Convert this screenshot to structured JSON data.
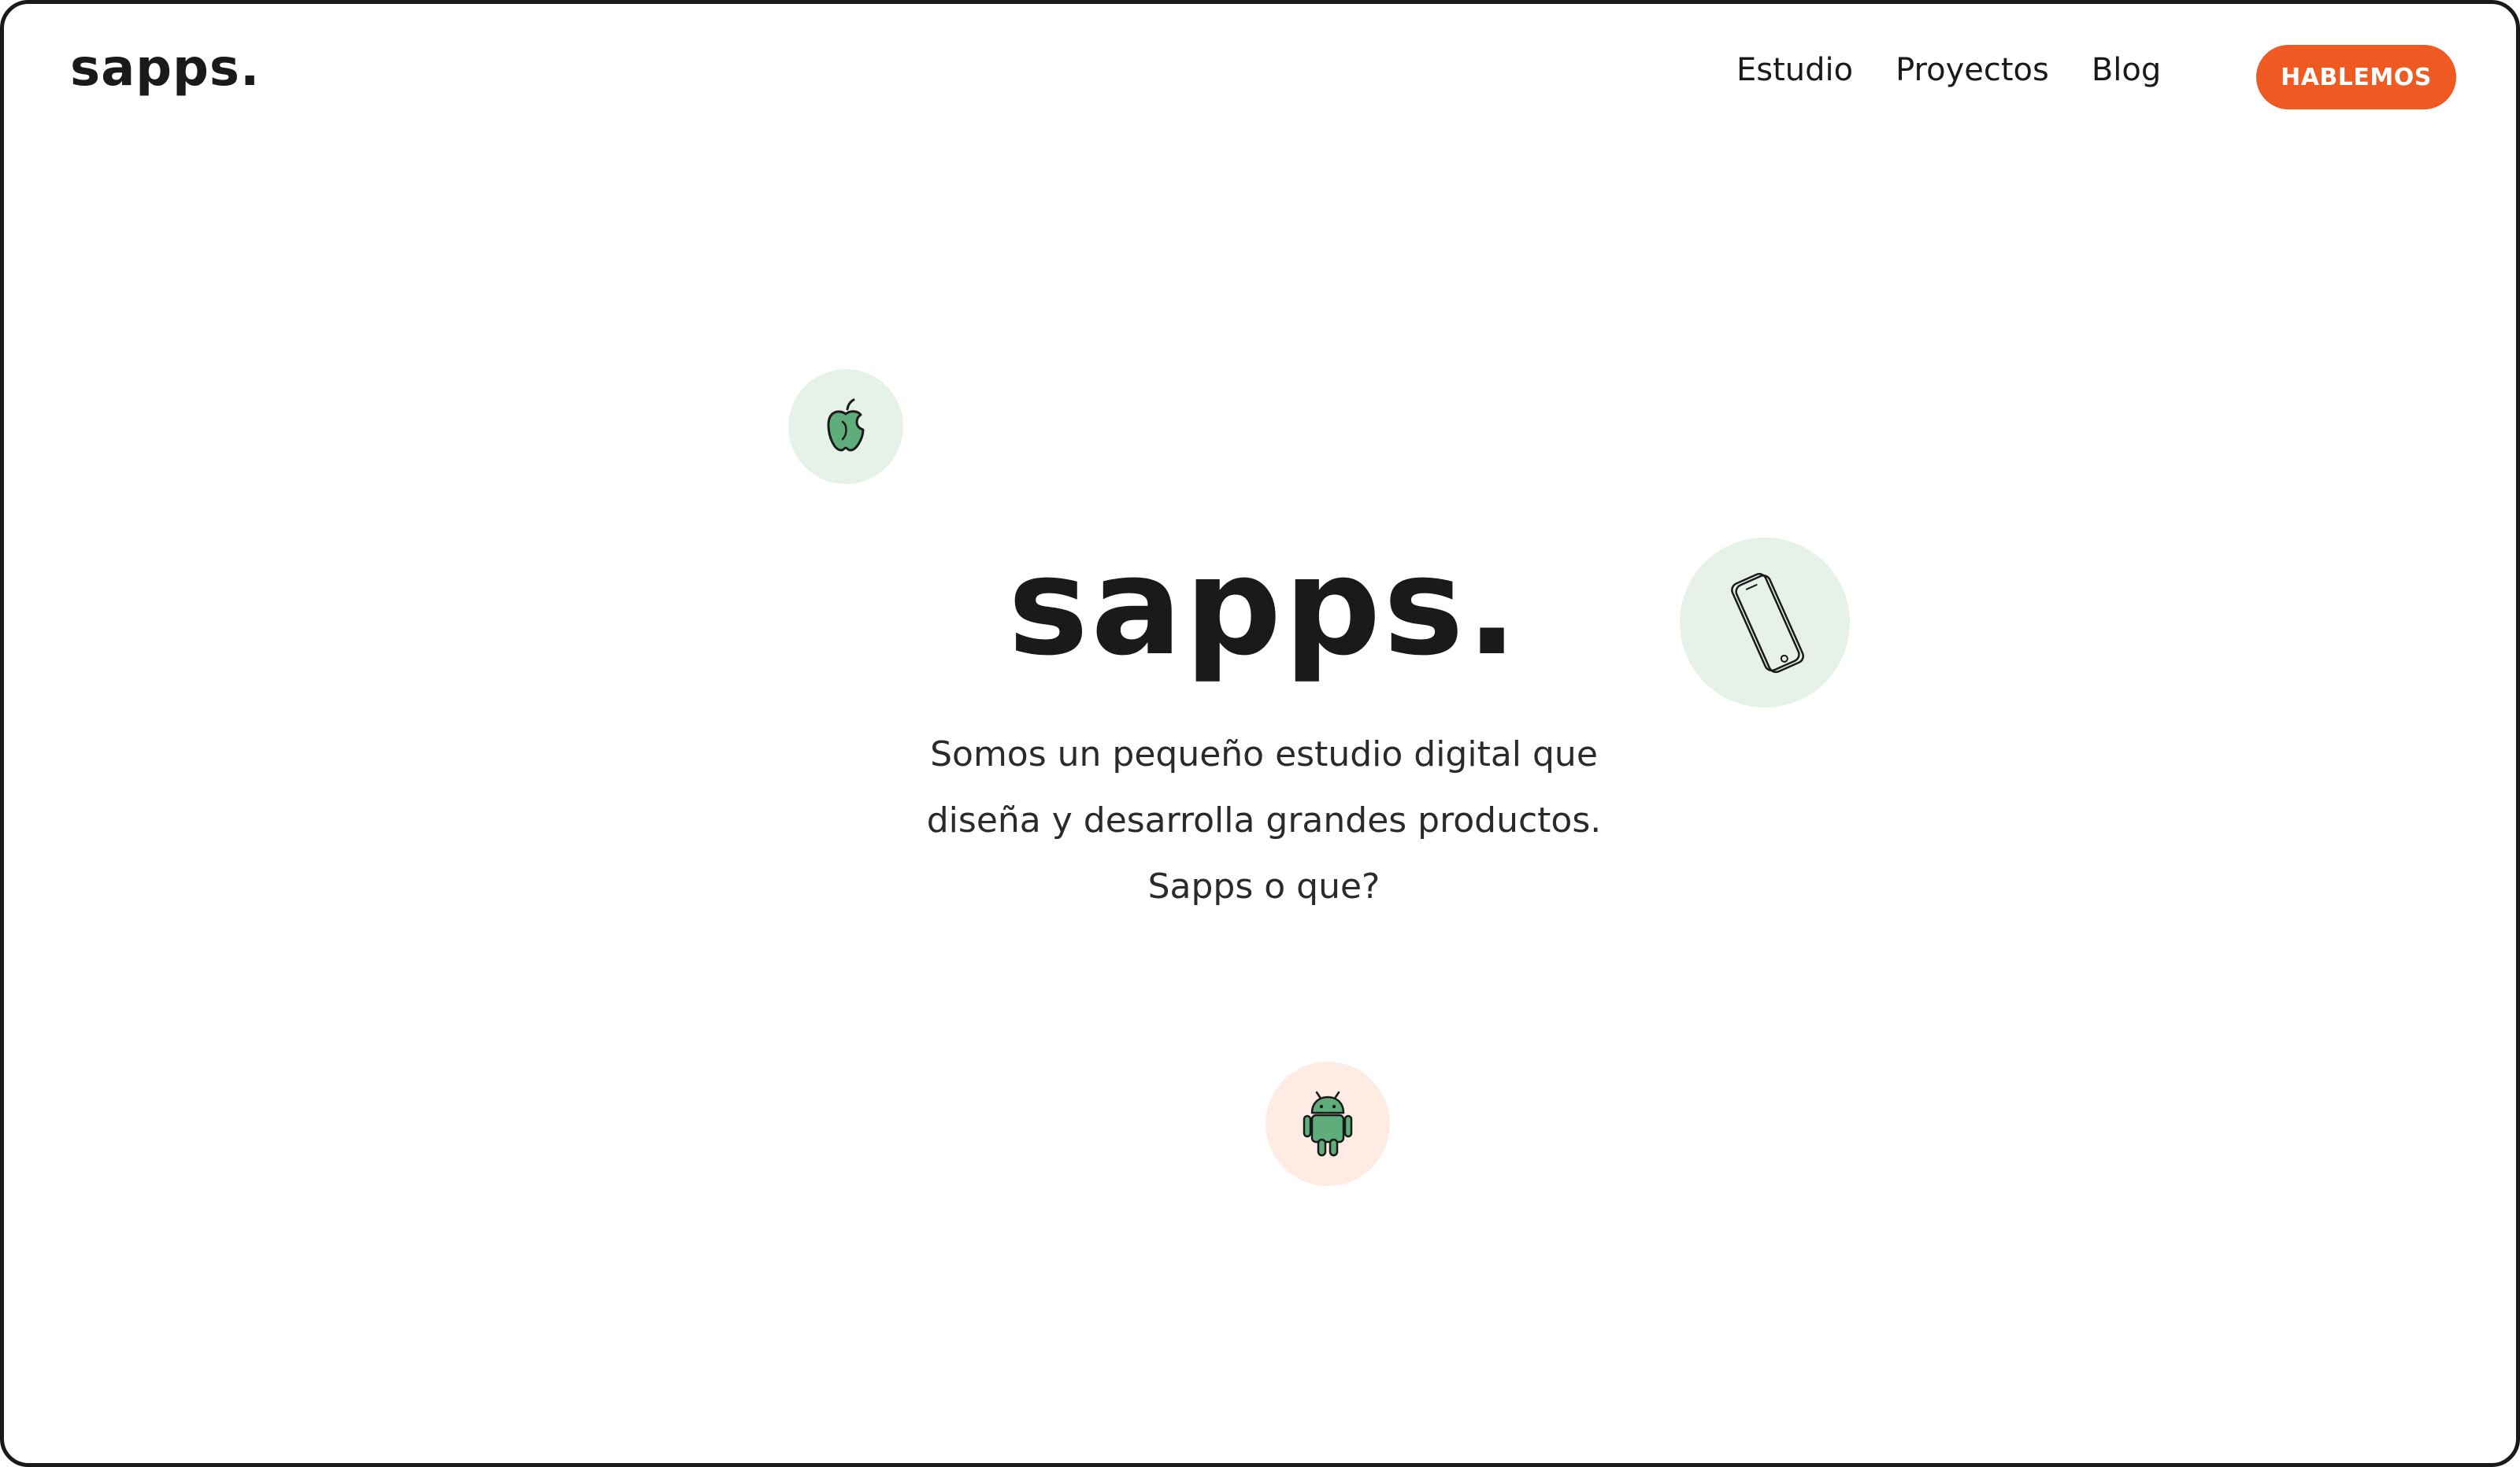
{
  "header": {
    "logo": "sapps.",
    "nav": [
      {
        "label": "Estudio"
      },
      {
        "label": "Proyectos"
      },
      {
        "label": "Blog"
      }
    ],
    "cta_label": "HABLEMOS"
  },
  "hero": {
    "title": "sapps.",
    "lines": [
      "Somos un pequeño estudio digital que",
      "diseña y desarrolla grandes productos.",
      "Sapps o que?"
    ]
  },
  "icons": {
    "apple": "apple-icon",
    "phone": "smartphone-icon",
    "android": "android-icon"
  },
  "colors": {
    "accent": "#ee5a22",
    "icon_green": "#5fad7a",
    "bubble_green": "#e6f1e8",
    "bubble_peach": "#fdebe4",
    "text": "#1a1a1a"
  }
}
